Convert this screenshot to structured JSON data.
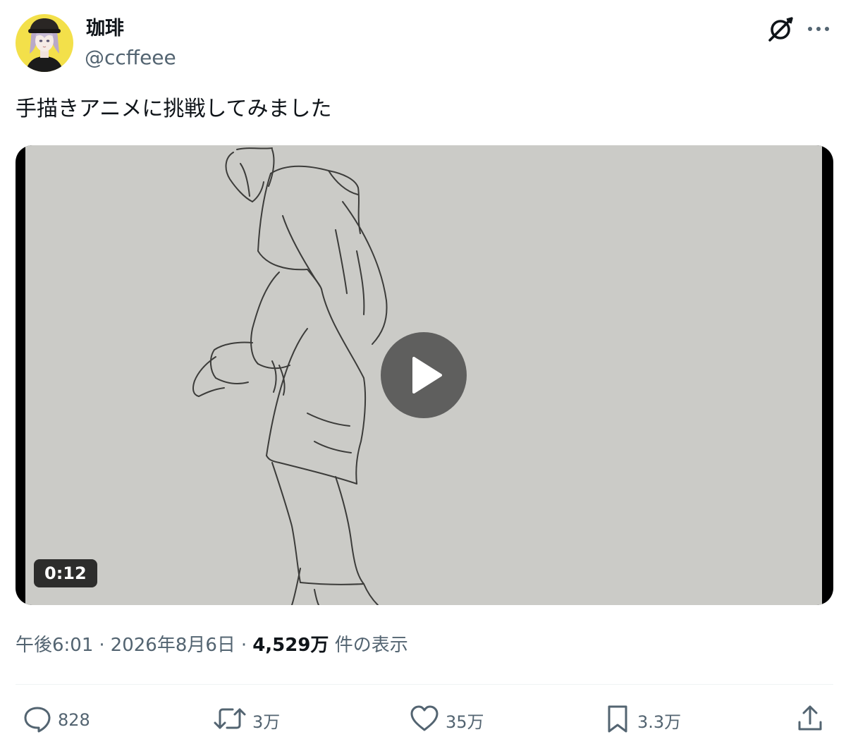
{
  "tweet": {
    "author": {
      "display_name": "珈琲",
      "handle": "@ccffeee",
      "avatar_bg": "#f3e04a"
    },
    "text": "手描きアニメに挑戦してみました",
    "media": {
      "type": "video",
      "duration": "0:12",
      "frame_color": "#cbcbc7"
    },
    "meta": {
      "time": "午後6:01",
      "date": "2026年8月6日",
      "views_count": "4,529万",
      "views_label": "件の表示"
    },
    "actions": {
      "replies": "828",
      "reposts": "3万",
      "likes": "35万",
      "bookmarks": "3.3万"
    }
  },
  "icons": {
    "header": [
      "grok-icon",
      "more-icon"
    ],
    "actions": [
      "reply-icon",
      "repost-icon",
      "like-icon",
      "bookmark-icon",
      "share-icon"
    ]
  }
}
